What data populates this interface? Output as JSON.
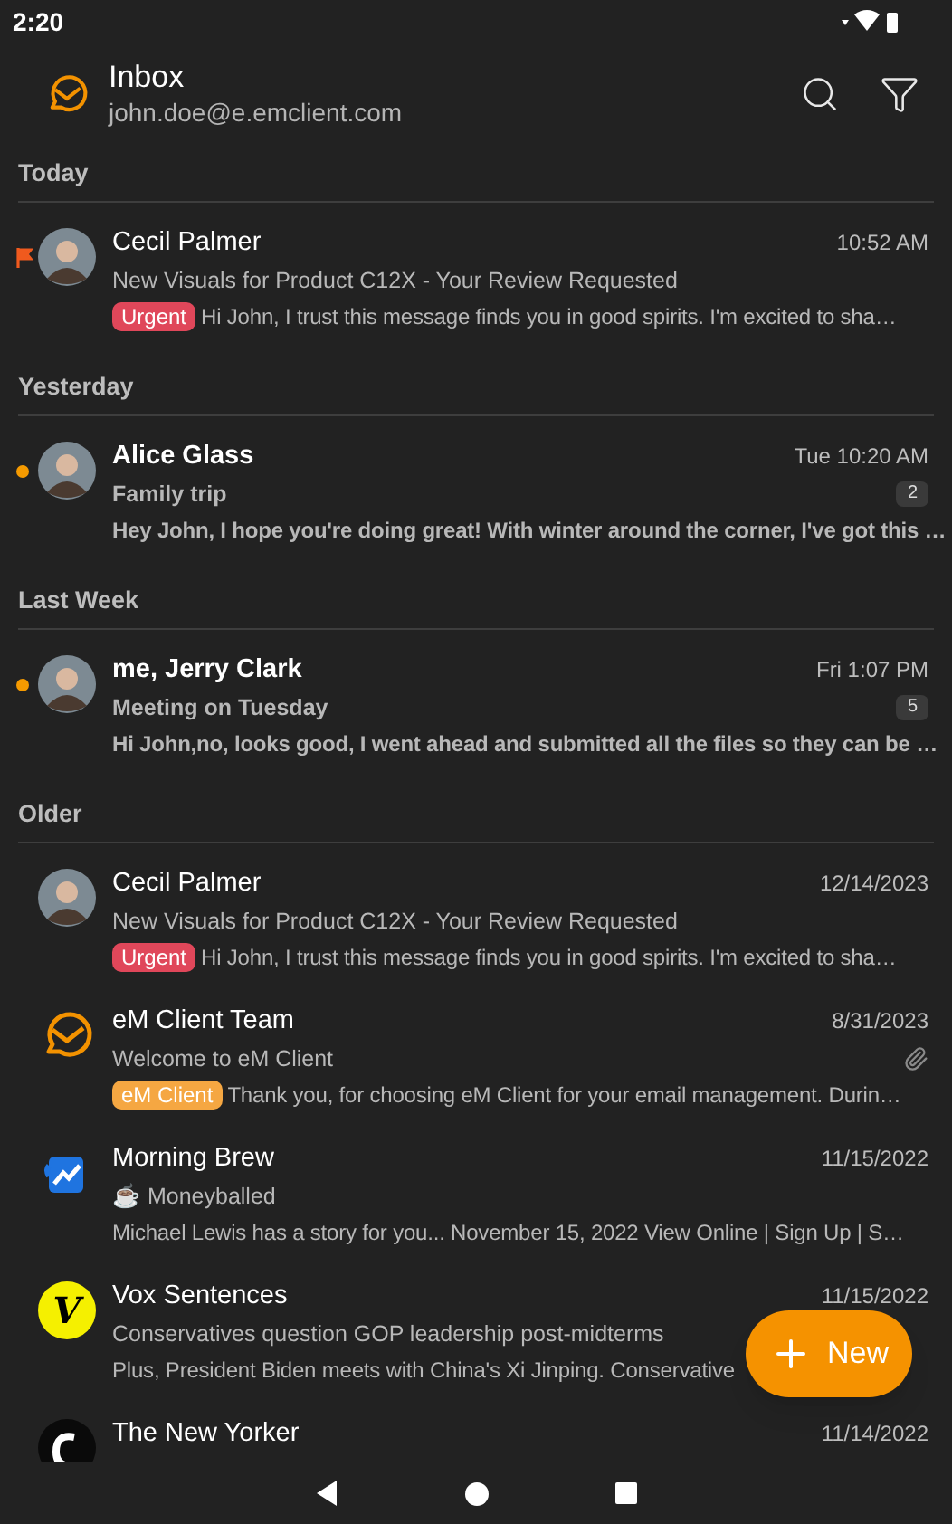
{
  "status_bar": {
    "time": "2:20"
  },
  "header": {
    "title": "Inbox",
    "account": "john.doe@e.emclient.com"
  },
  "sections": [
    {
      "label": "Today",
      "messages": [
        {
          "sender": "Cecil Palmer",
          "date": "10:52 AM",
          "subject": "New Visuals for Product C12X - Your Review Requested",
          "preview": "Hi John, I trust this message finds you in good spirits. I'm excited to sha…",
          "unread": false,
          "flagged": true,
          "attachment": false,
          "avatar": {
            "kind": "photo"
          },
          "tag": {
            "text": "Urgent",
            "color": "#e0475a"
          }
        }
      ]
    },
    {
      "label": "Yesterday",
      "messages": [
        {
          "sender": "Alice Glass",
          "date": "Tue 10:20 AM",
          "subject": "Family trip",
          "preview": "Hey John, I hope you're doing great! With winter around the corner, I've got this …",
          "unread": true,
          "flagged": false,
          "attachment": false,
          "count": "2",
          "avatar": {
            "kind": "photo"
          }
        }
      ]
    },
    {
      "label": "Last Week",
      "messages": [
        {
          "sender": "me, Jerry Clark",
          "date": "Fri 1:07 PM",
          "subject": "Meeting on Tuesday",
          "preview": "Hi John,no, looks good, I went ahead and submitted all the files so they can be …",
          "unread": true,
          "flagged": false,
          "attachment": false,
          "count": "5",
          "avatar": {
            "kind": "photo"
          }
        }
      ]
    },
    {
      "label": "Older",
      "messages": [
        {
          "sender": "Cecil Palmer",
          "date": "12/14/2023",
          "subject": "New Visuals for Product C12X - Your Review Requested",
          "preview": "Hi John, I trust this message finds you in good spirits. I'm excited to sha…",
          "unread": false,
          "flagged": false,
          "attachment": false,
          "avatar": {
            "kind": "photo"
          },
          "tag": {
            "text": "Urgent",
            "color": "#e0475a"
          }
        },
        {
          "sender": "eM Client Team",
          "date": "8/31/2023",
          "subject": "Welcome to eM Client",
          "preview": "Thank you, for choosing eM Client for your email management. Durin…",
          "unread": false,
          "flagged": false,
          "attachment": true,
          "avatar": {
            "kind": "envelope-logo"
          },
          "tag": {
            "text": "eM Client",
            "color": "#f5a742"
          }
        },
        {
          "sender": "Morning Brew",
          "date": "11/15/2022",
          "subject": "☕ Moneyballed",
          "preview": "Michael Lewis has a story for you... November 15, 2022 View Online | Sign Up | S…",
          "unread": false,
          "flagged": false,
          "attachment": false,
          "avatar": {
            "kind": "mug-logo"
          }
        },
        {
          "sender": "Vox Sentences",
          "date": "11/15/2022",
          "subject": "Conservatives question GOP leadership post-midterms",
          "preview": "Plus, President Biden meets with China's Xi Jinping. Conservative",
          "unread": false,
          "flagged": false,
          "attachment": false,
          "avatar": {
            "kind": "letter-logo",
            "text": "V"
          }
        },
        {
          "sender": "The New Yorker",
          "date": "11/14/2022",
          "unread": false,
          "flagged": false,
          "avatar": {
            "kind": "dark-logo"
          }
        }
      ]
    }
  ],
  "fab": {
    "label": "New"
  }
}
